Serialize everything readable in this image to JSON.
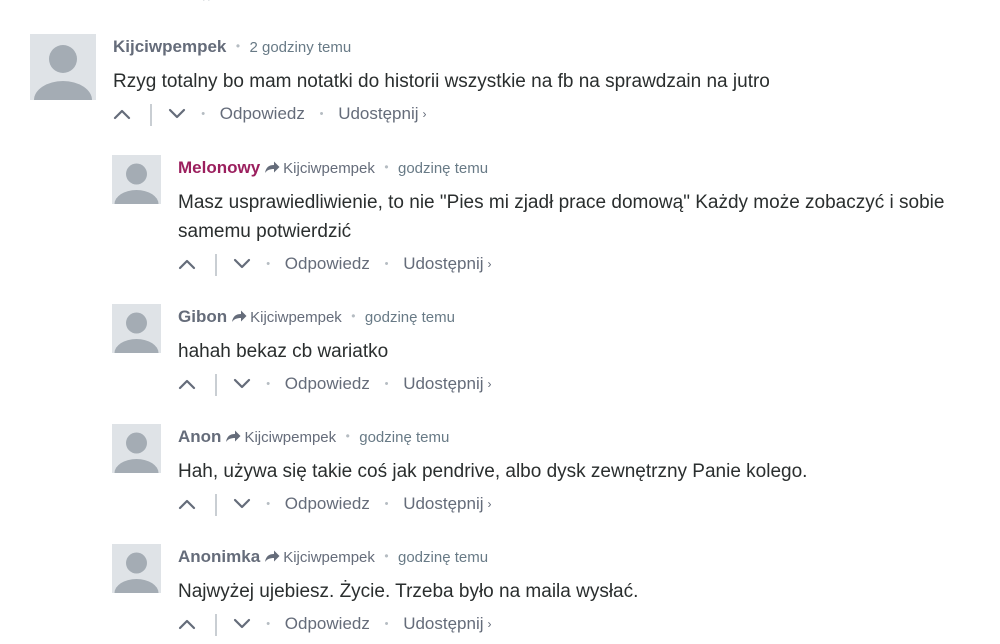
{
  "page": {
    "top_mark": "^"
  },
  "comments": [
    {
      "author": "Kijciwpempek",
      "reply_to": "",
      "time": "2 godziny temu",
      "text": "Rzyg totalny bo mam notatki do historii wszystkie na fb na sprawdzain na jutro",
      "author_color": "#656c7a"
    },
    {
      "author": "Melonowy",
      "reply_to": "Kijciwpempek",
      "time": "godzinę temu",
      "text": "Masz usprawiedliwienie, to nie \"Pies mi zjadł prace domową\" Każdy może zobaczyć i sobie samemu potwierdzić",
      "author_color": "#9b1f5e"
    },
    {
      "author": "Gibon",
      "reply_to": "Kijciwpempek",
      "time": "godzinę temu",
      "text": "hahah bekaz cb wariatko",
      "author_color": "#656c7a"
    },
    {
      "author": "Anon",
      "reply_to": "Kijciwpempek",
      "time": "godzinę temu",
      "text": "Hah, używa się takie coś jak pendrive, albo dysk zewnętrzny Panie kolego.",
      "author_color": "#656c7a"
    },
    {
      "author": "Anonimka",
      "reply_to": "Kijciwpempek",
      "time": "godzinę temu",
      "text": "Najwyżej ujebiesz. Życie. Trzeba było na maila wysłać.",
      "author_color": "#656c7a"
    }
  ],
  "actions": {
    "reply_label": "Odpowiedz",
    "share_label": "Udostępnij",
    "share_chevron": "›",
    "dot": "•"
  },
  "icons": {
    "upvote": "chevron-up-icon",
    "downvote": "chevron-down-icon",
    "reply_arrow": "share-arrow-icon",
    "avatar": "default-avatar-icon"
  }
}
